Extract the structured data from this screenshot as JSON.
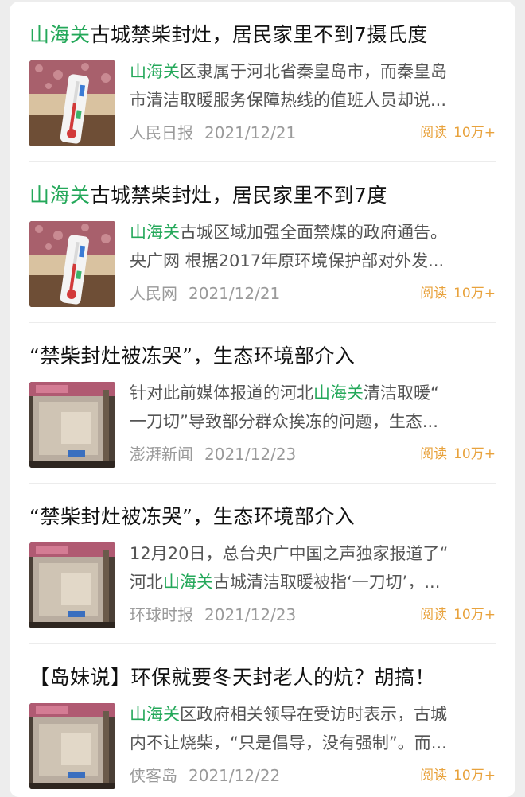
{
  "colors": {
    "highlight": "#24a85a",
    "reads": "#e8a23c",
    "meta": "#9a9a9a",
    "background": "#ededed",
    "card": "#ffffff"
  },
  "articles": [
    {
      "title_hl": "山海关",
      "title_rest": "古城禁柴封灶，居民家里不到7摄氏度",
      "snippet_line1_pre": "",
      "snippet_line1_hl": "山海关",
      "snippet_line1_post": "区隶属于河北省秦皇岛市，而秦皇岛",
      "snippet_line2_pre": "市清洁取暖服务保障热线的值班人员却说...",
      "snippet_line2_hl": "",
      "snippet_line2_post": "",
      "source": "人民日报",
      "date": "2021/12/21",
      "reads_label": "阅读",
      "reads_count": "10万+",
      "thumbnail": "thermometer-photo"
    },
    {
      "title_hl": "山海关",
      "title_rest": "古城禁柴封灶，居民家里不到7度",
      "snippet_line1_pre": "",
      "snippet_line1_hl": "山海关",
      "snippet_line1_post": "古城区域加强全面禁煤的政府通告。",
      "snippet_line2_pre": "央广网 根据2017年原环境保护部对外发...",
      "snippet_line2_hl": "",
      "snippet_line2_post": "",
      "source": "人民网",
      "date": "2021/12/21",
      "reads_label": "阅读",
      "reads_count": "10万+",
      "thumbnail": "thermometer-photo"
    },
    {
      "title_hl": "",
      "title_rest": "“禁柴封灶被冻哭”，生态环境部介入",
      "snippet_line1_pre": "针对此前媒体报道的河北",
      "snippet_line1_hl": "山海关",
      "snippet_line1_post": "清洁取暖“",
      "snippet_line2_pre": "一刀切”导致部分群众挨冻的问题，生态...",
      "snippet_line2_hl": "",
      "snippet_line2_post": "",
      "source": "澎湃新闻",
      "date": "2021/12/23",
      "reads_label": "阅读",
      "reads_count": "10万+",
      "thumbnail": "stove-photo"
    },
    {
      "title_hl": "",
      "title_rest": "“禁柴封灶被冻哭”，生态环境部介入",
      "snippet_line1_pre": "12月20日，总台央广中国之声独家报道了“",
      "snippet_line1_hl": "",
      "snippet_line1_post": "",
      "snippet_line2_pre": "河北",
      "snippet_line2_hl": "山海关",
      "snippet_line2_post": "古城清洁取暖被指‘一刀切’，...",
      "source": "环球时报",
      "date": "2021/12/23",
      "reads_label": "阅读",
      "reads_count": "10万+",
      "thumbnail": "stove-photo"
    },
    {
      "title_hl": "",
      "title_rest": "【岛妹说】环保就要冬天封老人的炕？胡搞！",
      "snippet_line1_pre": "",
      "snippet_line1_hl": "山海关",
      "snippet_line1_post": "区政府相关领导在受访时表示，古城",
      "snippet_line2_pre": "内不让烧柴，“只是倡导，没有强制”。而...",
      "snippet_line2_hl": "",
      "snippet_line2_post": "",
      "source": "侠客岛",
      "date": "2021/12/22",
      "reads_label": "阅读",
      "reads_count": "10万+",
      "thumbnail": "stove-photo"
    }
  ]
}
